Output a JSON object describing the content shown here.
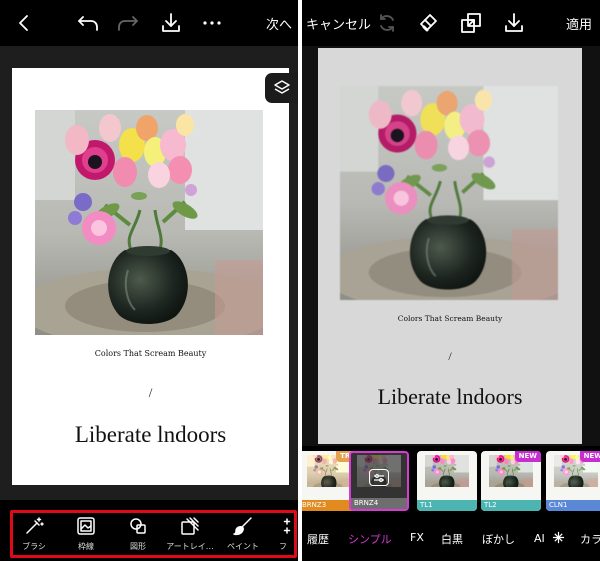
{
  "left": {
    "topbar": {
      "back_icon": "chevron-left-icon",
      "undo_icon": "undo-icon",
      "redo_icon": "redo-icon",
      "download_icon": "download-icon",
      "more_icon": "more-icon",
      "next_label": "次へ"
    },
    "document": {
      "caption": "Colors That Scream Beauty",
      "slash": "/",
      "headline": "Liberate lndoors"
    },
    "layers_icon": "layers-icon",
    "toolbar": [
      {
        "icon": "magic-brush-icon",
        "label": "ブラシ"
      },
      {
        "icon": "frame-icon",
        "label": "枠線"
      },
      {
        "icon": "shapes-icon",
        "label": "図形"
      },
      {
        "icon": "art-layer-icon",
        "label": "アートレイ…"
      },
      {
        "icon": "paint-brush-icon",
        "label": "ペイント"
      },
      {
        "icon": "sparkle-icon",
        "label": "フ"
      }
    ],
    "highlight_color": "#e0091a"
  },
  "right": {
    "topbar": {
      "cancel_label": "キャンセル",
      "refresh_icon": "refresh-icon",
      "eraser_icon": "eraser-icon",
      "compare_icon": "compare-icon",
      "download_icon": "download-icon",
      "apply_label": "適用"
    },
    "document": {
      "caption": "Colors That Scream Beauty",
      "slash": "/",
      "headline": "Liberate lndoors"
    },
    "filters": [
      {
        "name": "BRNZ3",
        "badge": "TRY",
        "badge_color": "#e4a14f",
        "label_color": "#e08a1f"
      },
      {
        "name": "BRNZ4",
        "badge": "",
        "badge_color": "",
        "label_color": "#6e6e6e",
        "selected": true,
        "adjust_icon": "adjust-icon"
      },
      {
        "name": "TL1",
        "badge": "",
        "badge_color": "",
        "label_color": "#4cb5b2"
      },
      {
        "name": "TL2",
        "badge": "NEW",
        "badge_color": "#c72ed1",
        "label_color": "#4cb5b2"
      },
      {
        "name": "CLN1",
        "badge": "NEW",
        "badge_color": "#c72ed1",
        "label_color": "#5a87d6"
      }
    ],
    "categories": [
      {
        "label": "履歴",
        "active": false
      },
      {
        "label": "シンプル",
        "active": true
      },
      {
        "label": "FX",
        "active": false
      },
      {
        "label": "白黒",
        "active": false
      },
      {
        "label": "ぼかし",
        "active": false
      },
      {
        "label": "AI",
        "active": false
      },
      {
        "label": "カラ",
        "active": false
      }
    ],
    "ai_icon": "sparkle-icon",
    "accent_color": "#d63bd4"
  }
}
